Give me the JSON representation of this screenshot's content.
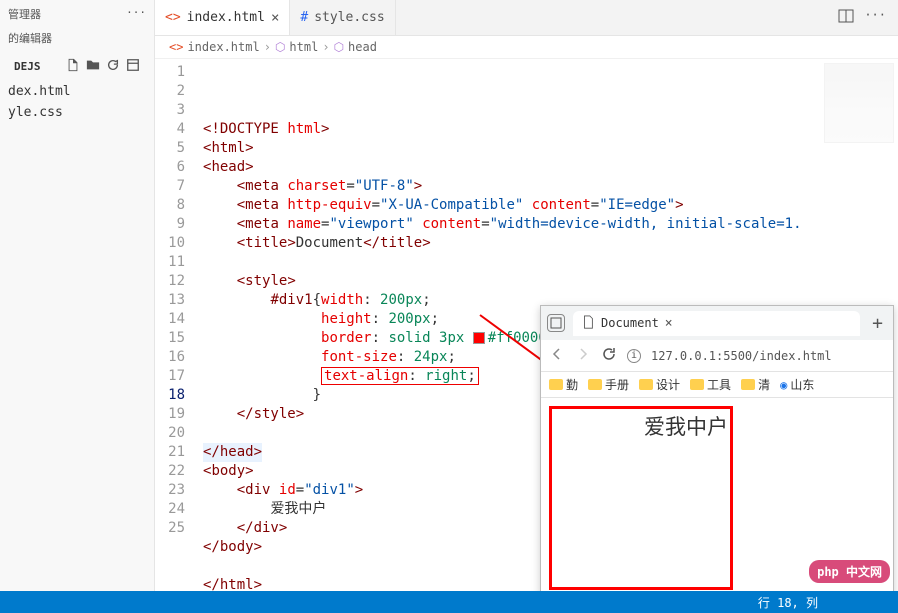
{
  "leftPanel": {
    "title": "管理器",
    "subtitle": "的编辑器",
    "section": "DEJS",
    "files": [
      "dex.html",
      "yle.css"
    ]
  },
  "tabs": [
    {
      "label": "index.html",
      "active": true,
      "icon": "html"
    },
    {
      "label": "style.css",
      "active": false,
      "icon": "css"
    }
  ],
  "breadcrumb": [
    "index.html",
    "html",
    "head"
  ],
  "code": {
    "lines": [
      {
        "n": 1,
        "html": "<span class='t-angle'>&lt;!</span><span class='t-tag'>DOCTYPE</span> <span class='t-attr'>html</span><span class='t-angle'>&gt;</span>"
      },
      {
        "n": 2,
        "html": "<span class='t-angle'>&lt;</span><span class='t-tag'>html</span><span class='t-angle'>&gt;</span>"
      },
      {
        "n": 3,
        "html": "<span class='t-angle'>&lt;</span><span class='t-tag'>head</span><span class='t-angle'>&gt;</span>"
      },
      {
        "n": 4,
        "html": "    <span class='t-angle'>&lt;</span><span class='t-tag'>meta</span> <span class='t-attr'>charset</span>=<span class='t-val'>\"UTF-8\"</span><span class='t-angle'>&gt;</span>"
      },
      {
        "n": 5,
        "html": "    <span class='t-angle'>&lt;</span><span class='t-tag'>meta</span> <span class='t-attr'>http-equiv</span>=<span class='t-val'>\"X-UA-Compatible\"</span> <span class='t-attr'>content</span>=<span class='t-val'>\"IE=edge\"</span><span class='t-angle'>&gt;</span>"
      },
      {
        "n": 6,
        "html": "    <span class='t-angle'>&lt;</span><span class='t-tag'>meta</span> <span class='t-attr'>name</span>=<span class='t-val'>\"viewport\"</span> <span class='t-attr'>content</span>=<span class='t-val'>\"width=device-width, initial-scale=1.</span>"
      },
      {
        "n": 7,
        "html": "    <span class='t-angle'>&lt;</span><span class='t-tag'>title</span><span class='t-angle'>&gt;</span><span class='t-text'>Document</span><span class='t-angle'>&lt;/</span><span class='t-tag'>title</span><span class='t-angle'>&gt;</span>"
      },
      {
        "n": 8,
        "html": ""
      },
      {
        "n": 9,
        "html": "    <span class='t-angle'>&lt;</span><span class='t-tag'>style</span><span class='t-angle'>&gt;</span>"
      },
      {
        "n": 10,
        "html": "        <span class='t-sel'>#div1</span>{<span class='t-prop'>width</span>: <span class='t-num'>200px</span>;"
      },
      {
        "n": 11,
        "html": "              <span class='t-prop'>height</span>: <span class='t-num'>200px</span>;"
      },
      {
        "n": 12,
        "html": "              <span class='t-prop'>border</span>: <span class='t-num'>solid</span> <span class='t-num'>3px</span> <span class='colorbox'></span><span class='t-num'>#ff0000</span>;"
      },
      {
        "n": 13,
        "html": "              <span class='t-prop'>font-size</span>: <span class='t-num'>24px</span>;"
      },
      {
        "n": 14,
        "html": "              <span class='red-box'><span class='t-prop'>text-align</span>: <span class='t-num'>right</span>;</span>"
      },
      {
        "n": 15,
        "html": "             }"
      },
      {
        "n": 16,
        "html": "    <span class='t-angle'>&lt;/</span><span class='t-tag'>style</span><span class='t-angle'>&gt;</span>"
      },
      {
        "n": 17,
        "html": ""
      },
      {
        "n": 18,
        "html": "<span class='sel-line'><span class='t-angle'>&lt;/</span><span class='t-tag'>head</span><span class='t-angle'>&gt;</span></span>",
        "current": true
      },
      {
        "n": 19,
        "html": "<span class='t-angle'>&lt;</span><span class='t-tag'>body</span><span class='t-angle'>&gt;</span>"
      },
      {
        "n": 20,
        "html": "    <span class='t-angle'>&lt;</span><span class='t-tag'>div</span> <span class='t-attr'>id</span>=<span class='t-val'>\"div1\"</span><span class='t-angle'>&gt;</span>"
      },
      {
        "n": 21,
        "html": "        <span class='t-text'>爱我中户</span>"
      },
      {
        "n": 22,
        "html": "    <span class='t-angle'>&lt;/</span><span class='t-tag'>div</span><span class='t-angle'>&gt;</span>"
      },
      {
        "n": 23,
        "html": "<span class='t-angle'>&lt;/</span><span class='t-tag'>body</span><span class='t-angle'>&gt;</span>"
      },
      {
        "n": 24,
        "html": ""
      },
      {
        "n": 25,
        "html": "<span class='t-angle'>&lt;/</span><span class='t-tag'>html</span><span class='t-angle'>&gt;</span>"
      }
    ]
  },
  "browser": {
    "tabTitle": "Document",
    "url": "127.0.0.1:5500/index.html",
    "bookmarks": [
      "勤",
      "手册",
      "设计",
      "工具",
      "清",
      "山东"
    ],
    "pageText": "爱我中户"
  },
  "status": "行 18, 列",
  "logo": "php 中文网"
}
